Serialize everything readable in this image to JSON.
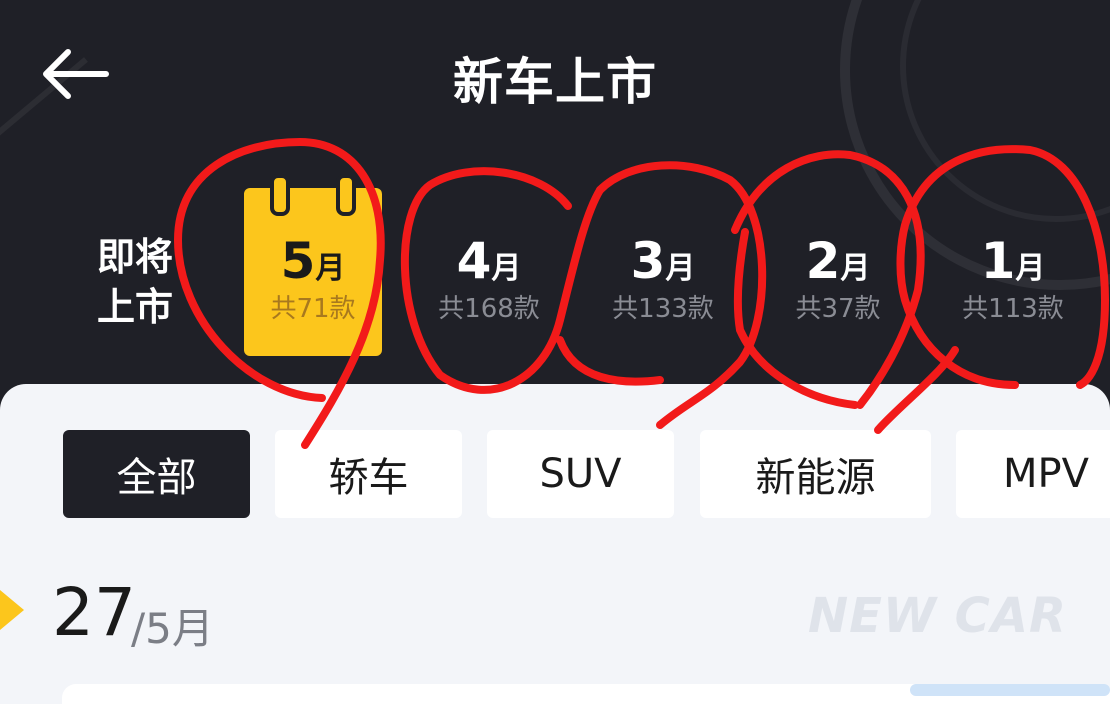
{
  "header": {
    "title": "新车上市",
    "upcoming_label": "即将上市"
  },
  "months": [
    {
      "num": "5",
      "unit": "月",
      "count": "共71款",
      "selected": true
    },
    {
      "num": "4",
      "unit": "月",
      "count": "共168款",
      "selected": false
    },
    {
      "num": "3",
      "unit": "月",
      "count": "共133款",
      "selected": false
    },
    {
      "num": "2",
      "unit": "月",
      "count": "共37款",
      "selected": false
    },
    {
      "num": "1",
      "unit": "月",
      "count": "共113款",
      "selected": false
    }
  ],
  "filters": [
    "全部",
    "轿车",
    "SUV",
    "新能源",
    "MPV"
  ],
  "active_filter": "全部",
  "date": {
    "day": "27",
    "month": "/5月"
  },
  "watermark": "NEW CAR",
  "colors": {
    "background": "#1f2027",
    "accent": "#fcc61c",
    "panel": "#f3f5f9",
    "annotation": "#f21a1a"
  }
}
